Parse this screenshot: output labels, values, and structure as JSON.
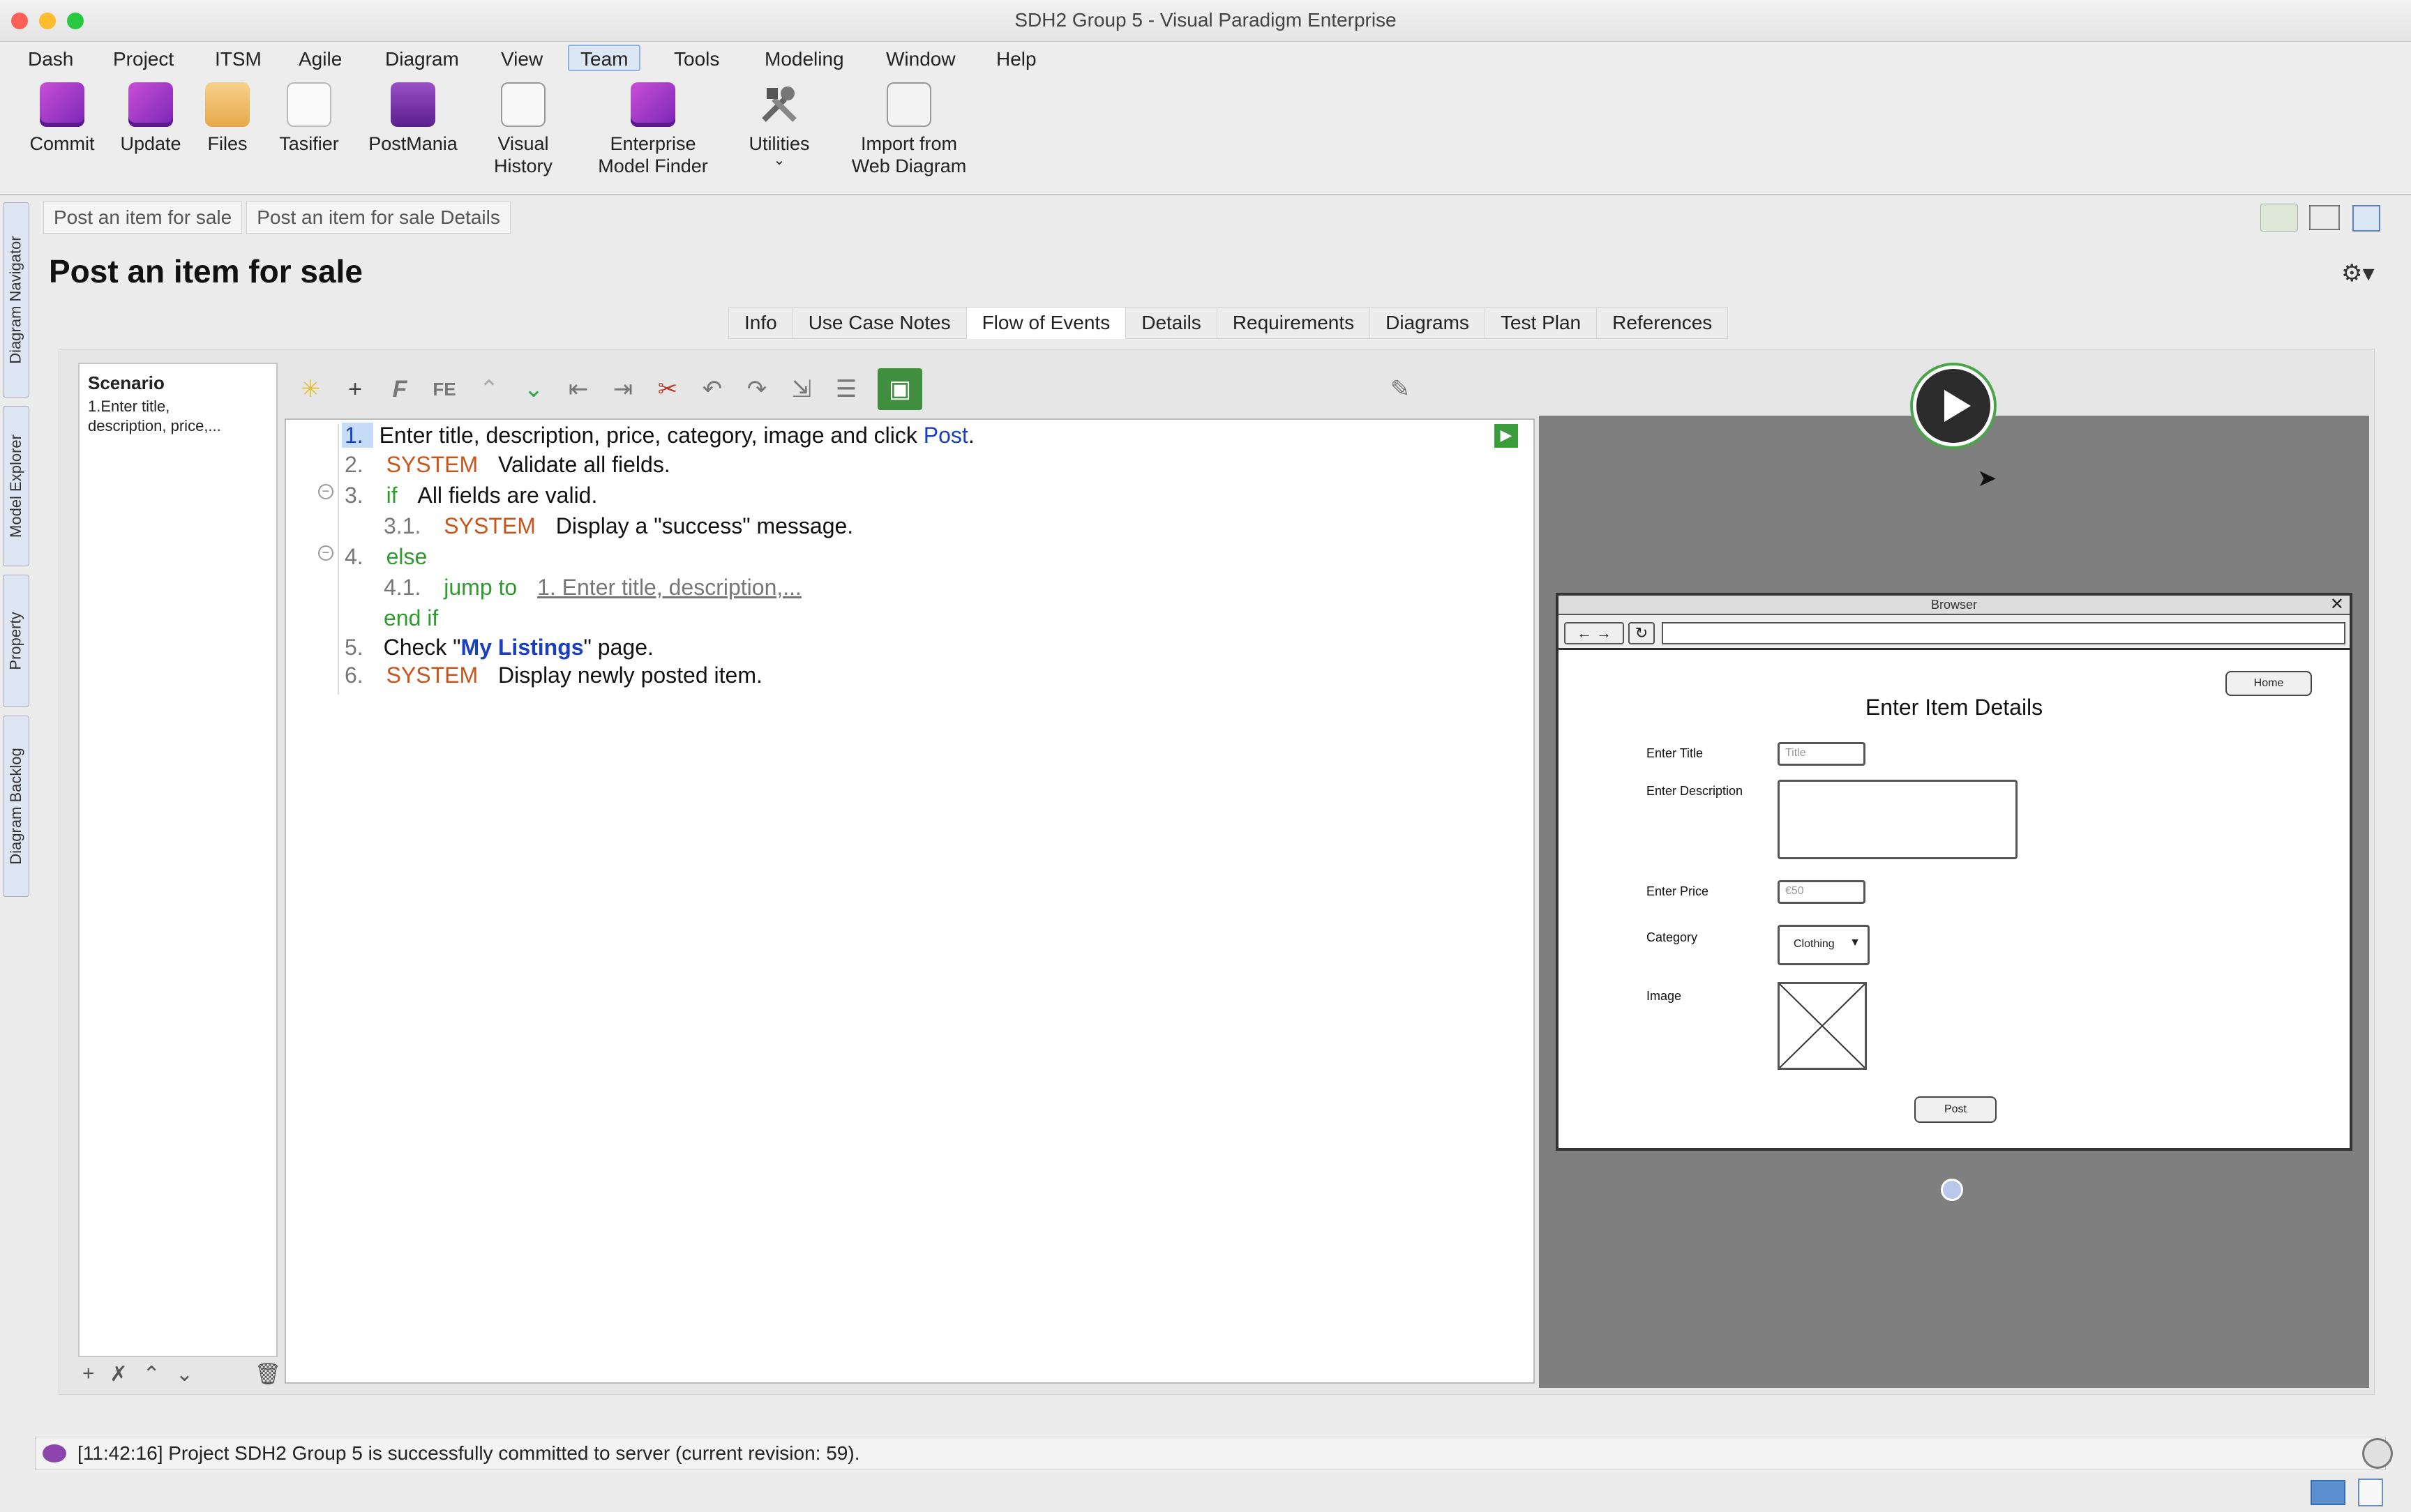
{
  "window": {
    "title": "SDH2 Group 5 - Visual Paradigm Enterprise"
  },
  "menu": [
    "Dash",
    "Project",
    "ITSM",
    "Agile",
    "Diagram",
    "View",
    "Team",
    "Tools",
    "Modeling",
    "Window",
    "Help"
  ],
  "active_menu": "Team",
  "ribbon": {
    "commit": "Commit",
    "update": "Update",
    "files": "Files",
    "tasifier": "Tasifier",
    "postmania": "PostMania",
    "visual_history_1": "Visual",
    "visual_history_2": "History",
    "enterprise_1": "Enterprise",
    "enterprise_2": "Model Finder",
    "utilities": "Utilities",
    "import_1": "Import from",
    "import_2": "Web Diagram"
  },
  "side_tabs": [
    "Diagram Navigator",
    "Model Explorer",
    "Property",
    "Diagram Backlog"
  ],
  "breadcrumb": [
    "Post an item for sale",
    "Post an item for sale Details"
  ],
  "page_title": "Post an item for sale",
  "tabs": [
    "Info",
    "Use Case Notes",
    "Flow of Events",
    "Details",
    "Requirements",
    "Diagrams",
    "Test Plan",
    "References"
  ],
  "active_tab": "Flow of Events",
  "scenario": {
    "title": "Scenario",
    "line1": "1.Enter title,",
    "line2": "description, price,..."
  },
  "flow": {
    "s1_num": "1.",
    "s1_text": "Enter title, description, price, category, image and click ",
    "s1_link": "Post",
    "s1_end": ".",
    "s2_num": "2.",
    "s2_kw": "SYSTEM",
    "s2_text": "Validate all fields.",
    "s3_num": "3.",
    "s3_kw": "if",
    "s3_text": "All fields are valid.",
    "s31_num": "3.1.",
    "s31_kw": "SYSTEM",
    "s31_text": "Display a \"success\" message.",
    "s4_num": "4.",
    "s4_kw": "else",
    "s41_num": "4.1.",
    "s41_kw": "jump to",
    "s41_link": "1. Enter title, description,...",
    "endif": "end if",
    "s5_num": "5.",
    "s5_pre": "Check \"",
    "s5_link": "My Listings",
    "s5_post": "\" page.",
    "s6_num": "6.",
    "s6_kw": "SYSTEM",
    "s6_text": "Display newly posted item."
  },
  "wireframe": {
    "browser_title": "Browser",
    "home": "Home",
    "heading": "Enter Item Details",
    "title_label": "Enter Title",
    "title_ph": "Title",
    "desc_label": "Enter Description",
    "price_label": "Enter Price",
    "price_ph": "€50",
    "category_label": "Category",
    "category_value": "Clothing",
    "image_label": "Image",
    "post": "Post"
  },
  "status": "[11:42:16] Project SDH2 Group 5 is successfully committed to server (current revision: 59)."
}
